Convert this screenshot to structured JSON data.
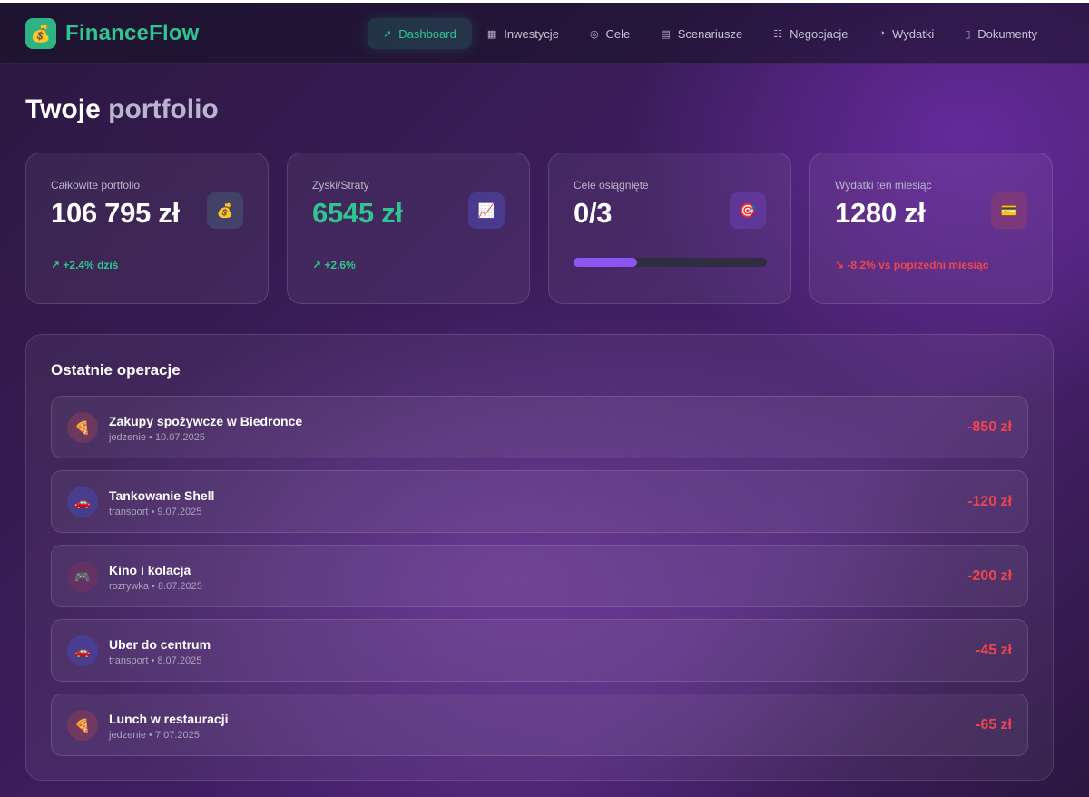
{
  "app": {
    "logo_icon": "money-bag-icon",
    "logo_glyph": "💰",
    "name": "FinanceFlow"
  },
  "nav": {
    "items": [
      {
        "label": "Dashboard",
        "icon": "trending-up-icon",
        "glyph": "↗",
        "active": true
      },
      {
        "label": "Inwestycje",
        "icon": "building-icon",
        "glyph": "▦",
        "active": false
      },
      {
        "label": "Cele",
        "icon": "target-check-icon",
        "glyph": "◎",
        "active": false
      },
      {
        "label": "Scenariusze",
        "icon": "document-icon",
        "glyph": "▤",
        "active": false
      },
      {
        "label": "Negocjacje",
        "icon": "users-icon",
        "glyph": "☷",
        "active": false
      },
      {
        "label": "Wydatki",
        "icon": "pie-chart-icon",
        "glyph": "◔",
        "active": false
      },
      {
        "label": "Dokumenty",
        "icon": "file-icon",
        "glyph": "▯",
        "active": false
      }
    ]
  },
  "page": {
    "title_part1": "Twoje",
    "title_part2": "portfolio"
  },
  "stats": {
    "portfolio": {
      "label": "Całkowite portfolio",
      "value": "106 795 zł",
      "icon": "money-bag-icon",
      "glyph": "💰",
      "trend": "↗ +2.4% dziś"
    },
    "profit": {
      "label": "Zyski/Straty",
      "value": "6545 zł",
      "icon": "chart-increasing-icon",
      "glyph": "📈",
      "trend": "↗ +2.6%"
    },
    "goals": {
      "label": "Cele osiągnięte",
      "value": "0/3",
      "icon": "target-icon",
      "glyph": "🎯",
      "progress": 0.33
    },
    "expenses": {
      "label": "Wydatki ten miesiąc",
      "value": "1280 zł",
      "icon": "credit-card-icon",
      "glyph": "💳",
      "trend": "↘ -8.2% vs poprzedni miesiąc"
    }
  },
  "colors": {
    "accent_green": "#2ec58e",
    "negative_red": "#f0454f",
    "progress_purple": "#8a55f0"
  },
  "transactions": {
    "title": "Ostatnie operacje",
    "items": [
      {
        "name": "Zakupy spożywcze w Biedronce",
        "meta": "jedzenie • 10.07.2025",
        "amount": "-850 zł",
        "icon": "pizza-icon",
        "glyph": "🍕"
      },
      {
        "name": "Tankowanie Shell",
        "meta": "transport • 9.07.2025",
        "amount": "-120 zł",
        "icon": "car-icon",
        "glyph": "🚗"
      },
      {
        "name": "Kino i kolacja",
        "meta": "rozrywka • 8.07.2025",
        "amount": "-200 zł",
        "icon": "game-controller-icon",
        "glyph": "🎮"
      },
      {
        "name": "Uber do centrum",
        "meta": "transport • 8.07.2025",
        "amount": "-45 zł",
        "icon": "car-icon",
        "glyph": "🚗"
      },
      {
        "name": "Lunch w restauracji",
        "meta": "jedzenie • 7.07.2025",
        "amount": "-65 zł",
        "icon": "pizza-icon",
        "glyph": "🍕"
      }
    ]
  }
}
